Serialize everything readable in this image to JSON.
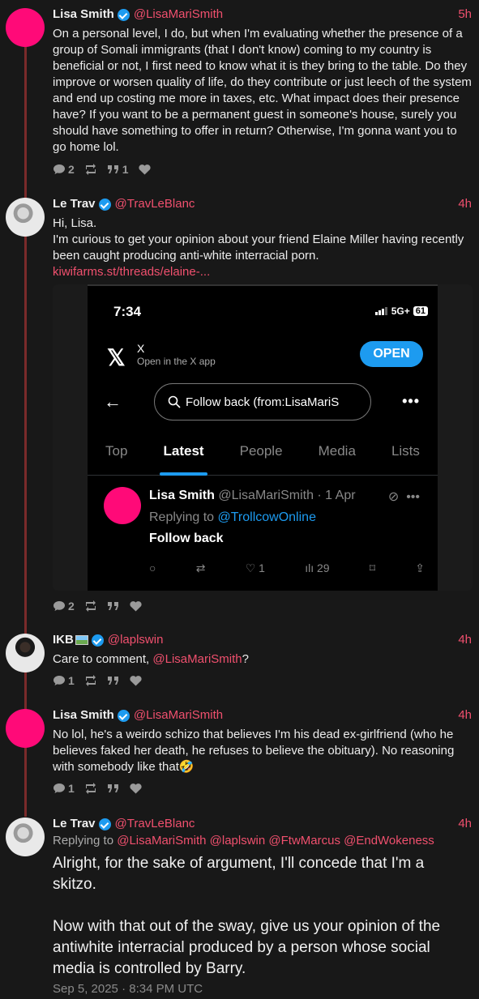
{
  "posts": [
    {
      "name": "Lisa Smith",
      "handle": "@LisaMariSmith",
      "time": "5h",
      "text": "On a personal level, I do, but when I'm evaluating whether the presence of a group of Somali immigrants (that I don't know) coming to my country is beneficial or not, I first need to know what it is they bring to the table. Do they improve or worsen quality of life, do they contribute or just leech of the system and end up costing me more in taxes, etc. What impact does their presence have? If you want to be a permanent guest in someone's house, surely you should have something to offer in return? Otherwise, I'm gonna want you to go home lol.",
      "replies": "2",
      "reposts": "",
      "quotes": "1",
      "likes": ""
    },
    {
      "name": "Le Trav",
      "handle": "@TravLeBlanc",
      "time": "4h",
      "text_line1": "Hi, Lisa.",
      "text_line2": "I'm curious to get your opinion about your friend Elaine Miller having recently been caught producing anti-white interracial porn.",
      "link": "kiwifarms.st/threads/elaine-...",
      "replies": "2",
      "reposts": "",
      "quotes": "",
      "likes": ""
    },
    {
      "name": "IKB",
      "handle": "@laplswin",
      "time": "4h",
      "text_pre": "Care to comment, ",
      "text_mention": "@LisaMariSmith",
      "text_post": "?",
      "replies": "1",
      "reposts": "",
      "quotes": "",
      "likes": ""
    },
    {
      "name": "Lisa Smith",
      "handle": "@LisaMariSmith",
      "time": "4h",
      "text": "No lol, he's a weirdo schizo that believes I'm his dead ex-girlfriend (who he believes faked her death, he refuses to believe the obituary). No reasoning with somebody like that🤣",
      "replies": "1",
      "reposts": "",
      "quotes": "",
      "likes": ""
    },
    {
      "name": "Le Trav",
      "handle": "@TravLeBlanc",
      "time": "4h",
      "replying_label": "Replying to",
      "replying_to": "@LisaMariSmith @laplswin @FtwMarcus @EndWokeness",
      "text_p1": "Alright, for the sake of argument, I'll concede that I'm a skitzo.",
      "text_p2": "Now with that out of the sway, give us your opinion of the antiwhite interracial produced by a person whose social media is controlled by Barry.",
      "timestamp": "Sep 5, 2025 · 8:34 PM UTC"
    }
  ],
  "embed": {
    "status_time": "7:34",
    "network": "5G+",
    "battery": "61",
    "app_name": "X",
    "open_in_app": "Open in the X app",
    "open_button": "OPEN",
    "search_query": "Follow back (from:LisaMariS",
    "tabs": [
      "Top",
      "Latest",
      "People",
      "Media",
      "Lists"
    ],
    "active_tab": "Latest",
    "tweet_name": "Lisa Smith",
    "tweet_handle_date": "@LisaMariSmith · 1 Apr",
    "tweet_replying": "Replying to",
    "tweet_replying_to": "@TrollcowOnline",
    "tweet_text": "Follow back",
    "tweet_likes": "1",
    "tweet_views": "29"
  },
  "colors": {
    "accent": "#f0506e",
    "avatar_pink": "#ff0a78",
    "thread_line": "#7a2a2a",
    "x_blue": "#1d9bf0"
  }
}
